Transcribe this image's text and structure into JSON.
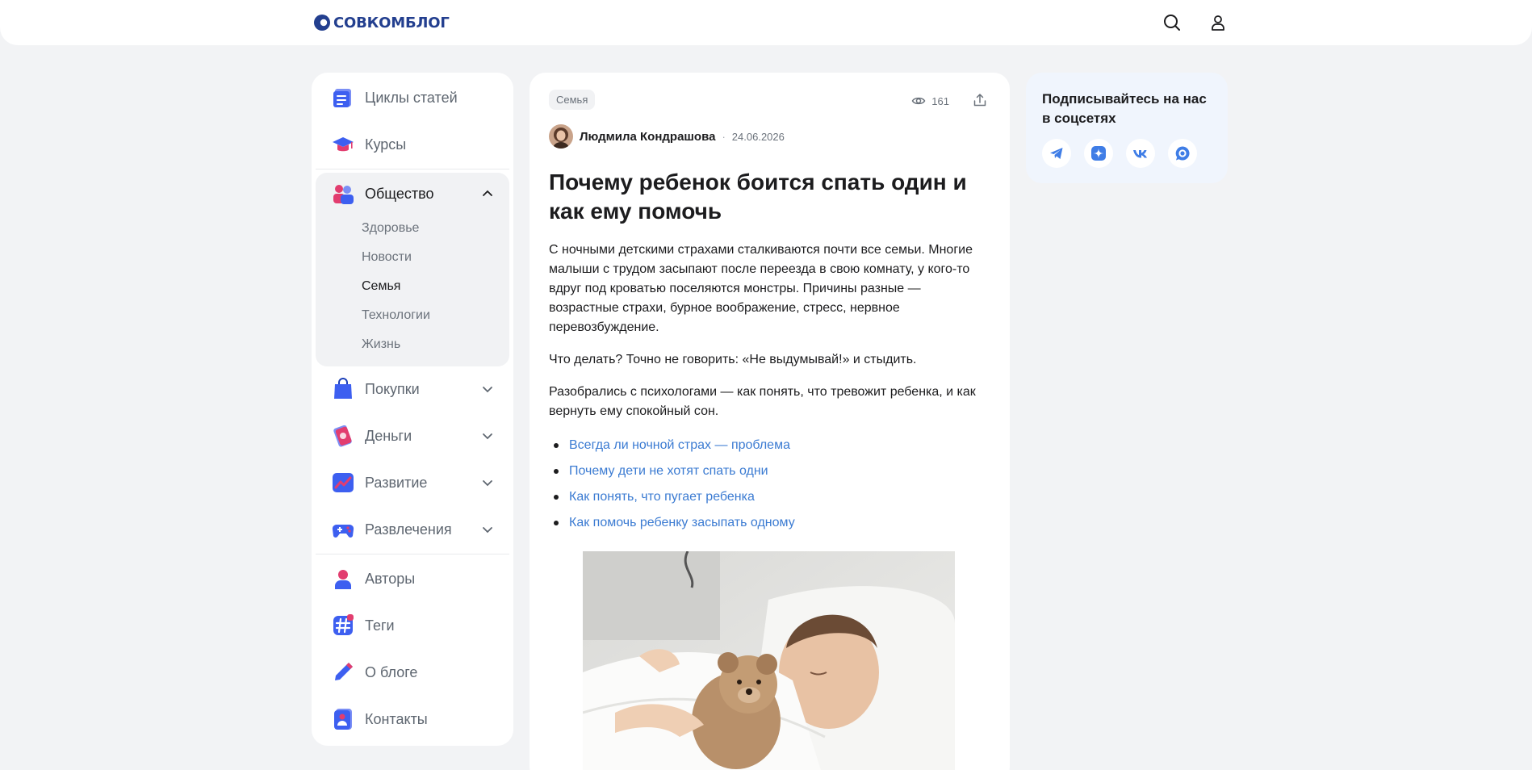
{
  "header": {
    "logo_text": "СОВКОМБЛОГ",
    "brand_colors": {
      "red": "#e4302f",
      "blue": "#233f8f"
    },
    "search_icon": "search-icon",
    "user_icon": "user-icon"
  },
  "sidebar": {
    "items": [
      {
        "label": "Циклы статей",
        "icon": "articles-icon"
      },
      {
        "label": "Курсы",
        "icon": "graduation-cap-icon"
      },
      {
        "label": "Общество",
        "icon": "people-icon",
        "expanded": true
      },
      {
        "label": "Покупки",
        "icon": "shopping-bag-icon"
      },
      {
        "label": "Деньги",
        "icon": "card-icon"
      },
      {
        "label": "Развитие",
        "icon": "growth-chart-icon"
      },
      {
        "label": "Развлечения",
        "icon": "gamepad-icon"
      },
      {
        "label": "Авторы",
        "icon": "person-icon"
      },
      {
        "label": "Теги",
        "icon": "hashtag-icon"
      },
      {
        "label": "О блоге",
        "icon": "pencil-icon"
      },
      {
        "label": "Контакты",
        "icon": "contacts-icon"
      }
    ],
    "subitems": [
      {
        "label": "Здоровье"
      },
      {
        "label": "Новости"
      },
      {
        "label": "Семья",
        "active": true
      },
      {
        "label": "Технологии"
      },
      {
        "label": "Жизнь"
      }
    ]
  },
  "article": {
    "tag": "Семья",
    "views": "161",
    "author": "Людмила Кондрашова",
    "date": "24.06.2026",
    "title": "Почему ребенок боится спать один и как ему помочь",
    "paragraphs": [
      "С ночными детскими страхами сталкиваются почти все семьи. Многие малыши с трудом засыпают после переезда в свою комнату, у кого-то вдруг под кроватью поселяются монстры. Причины разные — возрастные страхи, бурное воображение, стресс, нервное перевозбуждение.",
      "Что делать? Точно не говорить: «Не выдумывай!» и стыдить.",
      "Разобрались с психологами — как понять, что тревожит ребенка, и как вернуть ему спокойный сон."
    ],
    "toc": [
      "Всегда ли ночной страх — проблема",
      "Почему дети не хотят спать одни",
      "Как понять, что пугает ребенка",
      "Как помочь ребенку засыпать одному"
    ],
    "link_color": "#3b7bd2"
  },
  "social": {
    "title": "Подписывайтесь на нас в соцсетях",
    "networks": [
      "telegram-icon",
      "dzen-icon",
      "vk-icon",
      "max-messenger-icon"
    ],
    "accent": "#3f7de6"
  }
}
